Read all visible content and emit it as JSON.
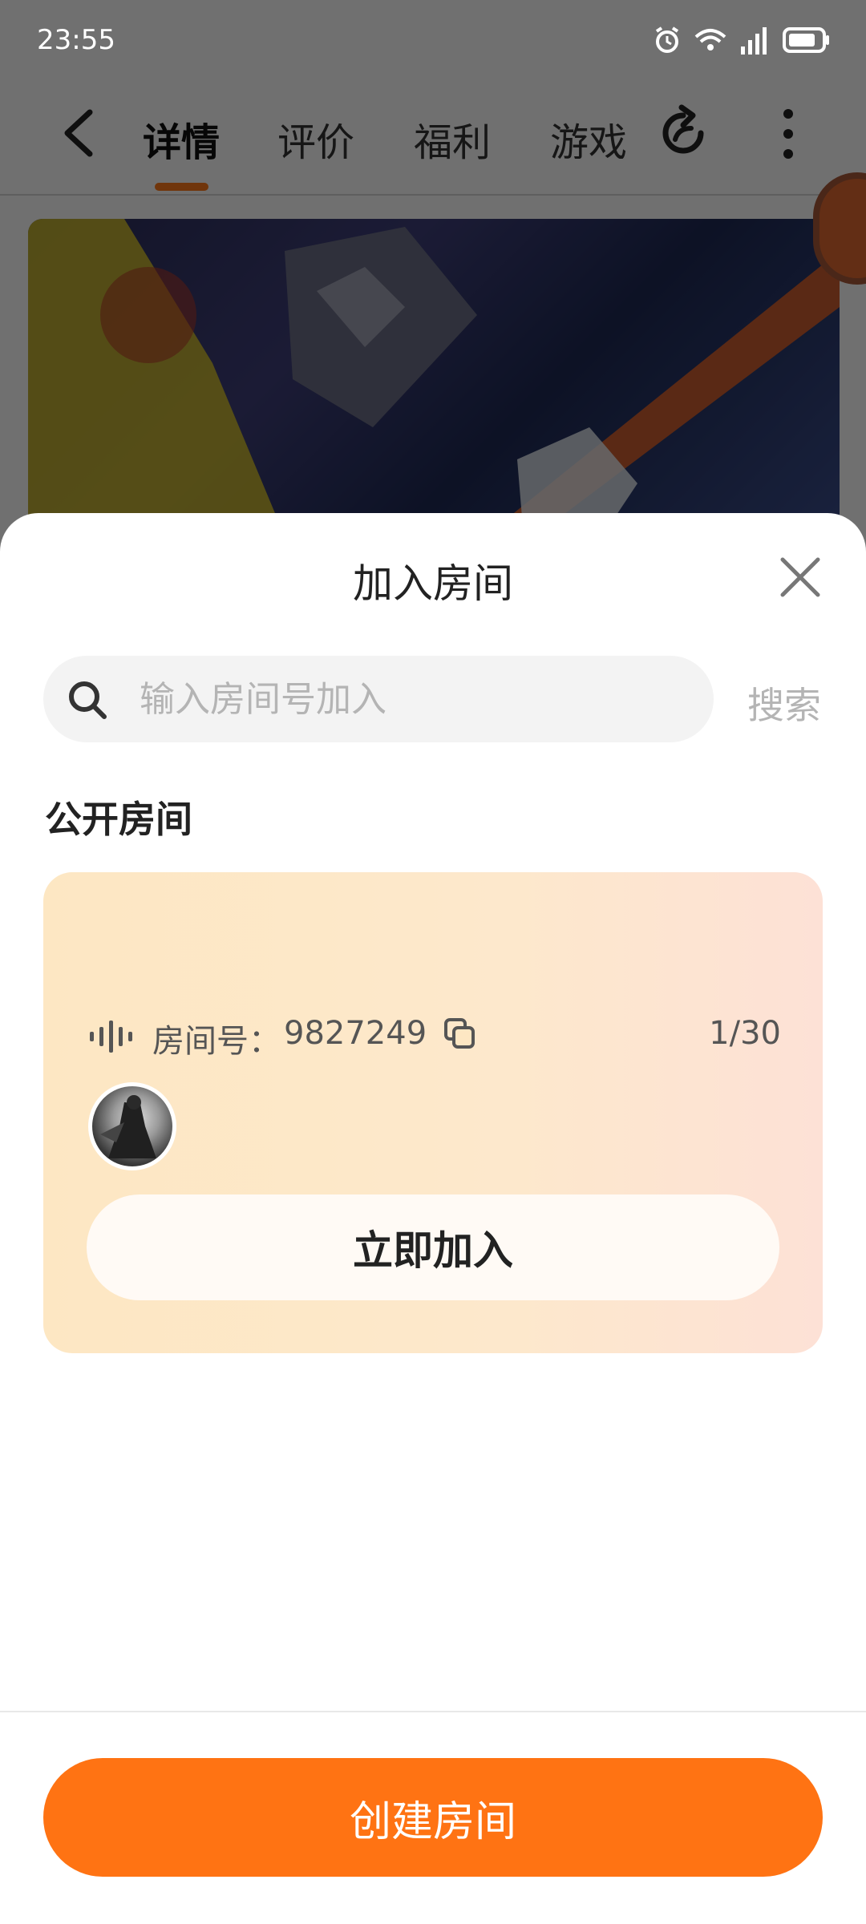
{
  "status_bar": {
    "time": "23:55"
  },
  "nav": {
    "tabs": [
      {
        "label": "详情",
        "active": true
      },
      {
        "label": "评价",
        "active": false
      },
      {
        "label": "福利",
        "active": false
      },
      {
        "label": "游戏",
        "active": false
      }
    ]
  },
  "sheet": {
    "title": "加入房间",
    "search": {
      "placeholder": "输入房间号加入",
      "value": "",
      "button_label": "搜索"
    },
    "section_title": "公开房间",
    "rooms": [
      {
        "number_label": "房间号：",
        "number": "9827249",
        "occupancy": "1/30",
        "join_label": "立即加入"
      }
    ],
    "create_label": "创建房间"
  },
  "colors": {
    "accent": "#ff7313",
    "tab_indicator": "#ff7a1a",
    "card_bg": "#fde7c3",
    "placeholder": "#b4b4b4"
  }
}
